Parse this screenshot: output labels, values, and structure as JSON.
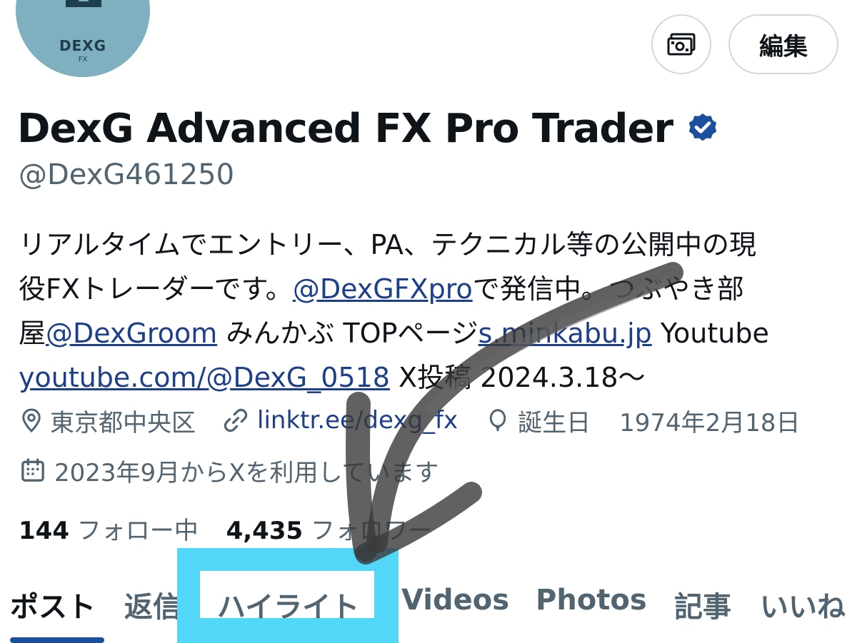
{
  "profile": {
    "avatar_name": "DEXG",
    "avatar_sub": "FX",
    "display_name": "DexG Advanced FX Pro Trader",
    "handle": "@DexG461250",
    "edit_label": "編集",
    "bio": {
      "line1": "リアルタイムでエントリー、PA、テクニカル等の公開中の現",
      "line2_a": "役FXトレーダーです。",
      "line2_link": "@DexGFXpro",
      "line2_b": "で発信中。つぶやき部",
      "line3_a": "屋",
      "line3_link1": "@DexGroom",
      "line3_b": " みんかぶ TOPページ",
      "line3_link2": "s.minkabu.jp",
      "line3_c": " Youtube",
      "line4_link": "youtube.com/@DexG_0518",
      "line4_b": " X投稿 2024.3.18～"
    },
    "location": "東京都中央区",
    "website": "linktr.ee/dexg_fx",
    "birthday_label": "誕生日",
    "birthday_date": "1974年2月18日",
    "joined": "2023年9月からXを利用しています",
    "following_count": "144",
    "following_label": "フォロー中",
    "followers_count": "4,435",
    "followers_label": "フォロワー"
  },
  "tabs": [
    {
      "label": "ポスト"
    },
    {
      "label": "返信"
    },
    {
      "label": "ハイライト"
    },
    {
      "label": "Videos"
    },
    {
      "label": "Photos"
    },
    {
      "label": "記事"
    },
    {
      "label": "いいね"
    }
  ],
  "colors": {
    "accent_link": "#1d3f8a",
    "highlight_box": "#52d7f9",
    "verified_badge": "#1d4f9f"
  },
  "icons": [
    "dollar-bill-icon",
    "verified-badge-icon",
    "location-pin-icon",
    "link-icon",
    "balloon-icon",
    "calendar-icon"
  ]
}
